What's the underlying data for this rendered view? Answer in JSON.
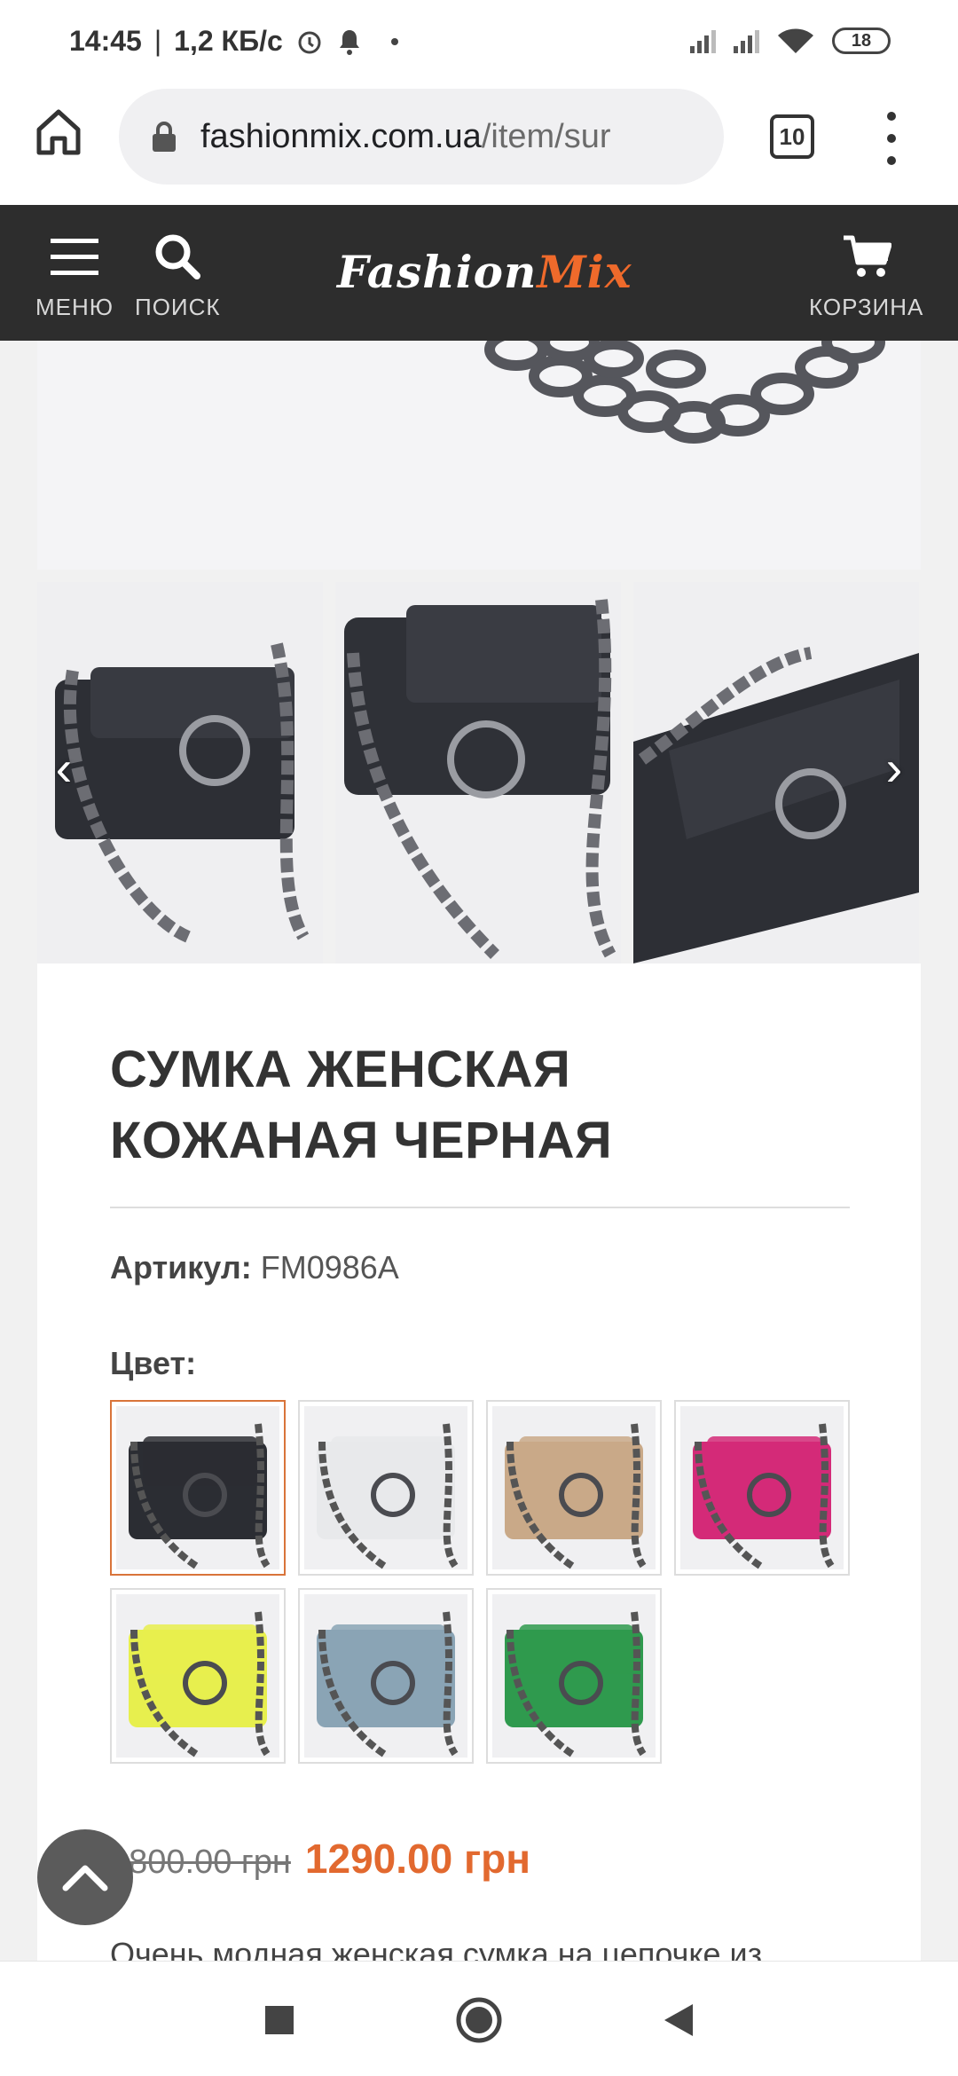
{
  "status": {
    "time": "14:45",
    "net_speed": "1,2 КБ/с",
    "battery": "18"
  },
  "browser": {
    "url_domain": "fashionmix.com.ua",
    "url_path": "/item/sur",
    "tab_count": "10"
  },
  "header": {
    "menu_label": "МЕНЮ",
    "search_label": "ПОИСК",
    "logo_part1": "Fashion",
    "logo_part2": "Mix",
    "cart_label": "КОРЗИНА"
  },
  "gallery": {
    "thumbnails": [
      "black bag front",
      "black bag close-up",
      "black bag angle"
    ]
  },
  "product": {
    "title": "СУМКА ЖЕНСКАЯ КОЖАНАЯ ЧЕРНАЯ",
    "sku_label": "Артикул:",
    "sku_value": "FM0986A",
    "color_label": "Цвет:",
    "colors": [
      {
        "name": "black",
        "hex": "#2b2d33",
        "selected": true
      },
      {
        "name": "white",
        "hex": "#e8e9eb",
        "selected": false
      },
      {
        "name": "beige",
        "hex": "#c9a988",
        "selected": false
      },
      {
        "name": "pink",
        "hex": "#d42a78",
        "selected": false
      },
      {
        "name": "yellow",
        "hex": "#e7ef4e",
        "selected": false
      },
      {
        "name": "blue",
        "hex": "#8aa4b5",
        "selected": false
      },
      {
        "name": "green",
        "hex": "#2f9a4e",
        "selected": false
      }
    ],
    "old_price": "1800.00 грн",
    "new_price": "1290.00 грн",
    "description_start": "Очень модная женская сумка на цепочке из"
  },
  "theme": {
    "accent": "#e2692f",
    "header_bg": "#2d2d2d"
  }
}
